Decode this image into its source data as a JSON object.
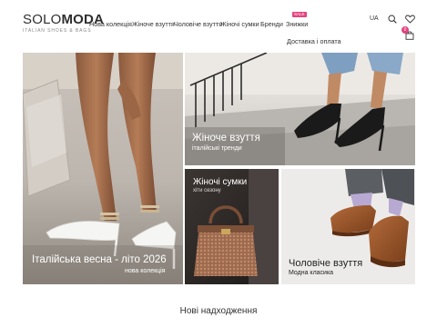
{
  "header": {
    "logo_main_left": "SOLO",
    "logo_main_right": "MODA",
    "logo_sub": "ITALIAN SHOES & BAGS",
    "nav": [
      {
        "label": "Нова колекція"
      },
      {
        "label": "Жіноче взуття"
      },
      {
        "label": "Чоловіче взуття"
      },
      {
        "label": "Жіночі сумки"
      },
      {
        "label": "Бренди"
      },
      {
        "label": "Знижки",
        "badge": "SALE"
      }
    ],
    "nav_second_row": "Доставка і оплата",
    "language": "UA",
    "icons": [
      "search-icon",
      "heart-icon",
      "bag-icon"
    ],
    "cart_count": "0"
  },
  "banners": [
    {
      "title": "Італійська весна - літо 2026",
      "subtitle": "нова колекція"
    },
    {
      "title": "Жіноче взуття",
      "subtitle": "італійські тренди"
    },
    {
      "title": "Жіночі сумки",
      "subtitle": "хіти сезону"
    },
    {
      "title": "Чоловіче взуття",
      "subtitle": "Модна класика"
    }
  ],
  "sections": {
    "new_arrivals_title": "Нові надходження"
  },
  "colors": {
    "accent": "#e3427f",
    "text": "#333333"
  }
}
